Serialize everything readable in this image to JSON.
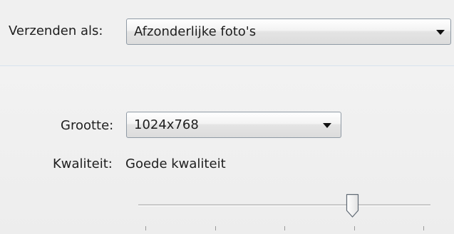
{
  "send_as": {
    "label": "Verzenden als:",
    "selected": "Afzonderlijke foto's"
  },
  "size": {
    "label": "Grootte:",
    "selected": "1024x768"
  },
  "quality": {
    "label": "Kwaliteit:",
    "value_text": "Goede kwaliteit",
    "slider_level_fraction": 0.733,
    "tick_count": 5
  },
  "icons": {
    "dropdown_arrow": "chevron-down-icon"
  },
  "colors": {
    "divider": "#d6e3ee",
    "combo_border": "#8f9aa5",
    "thumb_border": "#606a74"
  }
}
